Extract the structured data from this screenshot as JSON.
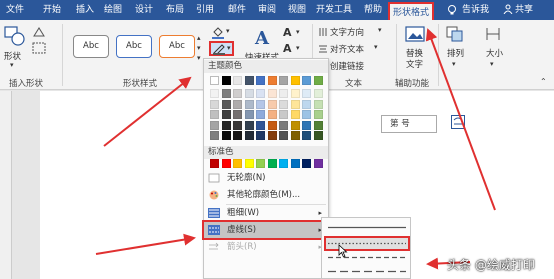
{
  "tabs": [
    {
      "label": "文件"
    },
    {
      "label": "开始"
    },
    {
      "label": "插入"
    },
    {
      "label": "绘图"
    },
    {
      "label": "设计"
    },
    {
      "label": "布局"
    },
    {
      "label": "引用"
    },
    {
      "label": "邮件"
    },
    {
      "label": "审阅"
    },
    {
      "label": "视图"
    },
    {
      "label": "开发工具"
    },
    {
      "label": "帮助"
    },
    {
      "label": "形状格式"
    }
  ],
  "tell_me": "告诉我",
  "share": "共享",
  "ribbon": {
    "insert_shape_group": "插入形状",
    "shape_label": "形状",
    "shape_styles_group": "形状样式",
    "abc_label": "Abc",
    "quick_styles": "快速样式",
    "text_group": "文本",
    "text_direction": "文字方向",
    "align_text": "对齐文本",
    "create_link": "创建链接",
    "accessibility_group": "辅助功能",
    "alt_text_line1": "替换",
    "alt_text_line2": "文字",
    "arrange": "排列",
    "size": "大小"
  },
  "menu": {
    "theme_colors": "主题颜色",
    "standard_colors": "标准色",
    "no_outline": "无轮廓(N)",
    "more_colors": "其他轮廓颜色(M)...",
    "weight": "粗细(W)",
    "dashes": "虚线(S)",
    "arrows": "箭头(R)"
  },
  "colors": {
    "theme_top": [
      "#ffffff",
      "#000000",
      "#e7e6e6",
      "#44546a",
      "#4472c4",
      "#ed7d31",
      "#a5a5a5",
      "#ffc000",
      "#5b9bd5",
      "#70ad47"
    ],
    "theme_shades": [
      [
        "#f2f2f2",
        "#7f7f7f",
        "#d0cece",
        "#d6dce4",
        "#d9e2f3",
        "#fbe5d5",
        "#ededed",
        "#fff2cc",
        "#deebf6",
        "#e2efd9"
      ],
      [
        "#d8d8d8",
        "#595959",
        "#aeabab",
        "#adb9ca",
        "#b4c6e7",
        "#f7cbac",
        "#dbdbdb",
        "#fee599",
        "#bdd7ee",
        "#c5e0b3"
      ],
      [
        "#bfbfbf",
        "#3f3f3f",
        "#757070",
        "#8496b0",
        "#8eaadb",
        "#f4b183",
        "#c9c9c9",
        "#ffd965",
        "#9cc3e5",
        "#a8d08d"
      ],
      [
        "#a5a5a5",
        "#262626",
        "#3a3838",
        "#323f4f",
        "#2f5496",
        "#c55a11",
        "#7b7b7b",
        "#bf9000",
        "#2e75b5",
        "#538135"
      ],
      [
        "#7f7f7f",
        "#0c0c0c",
        "#171616",
        "#222a35",
        "#1f3864",
        "#833c0b",
        "#525252",
        "#7f6000",
        "#1e4e79",
        "#375623"
      ]
    ],
    "standard": [
      "#c00000",
      "#ff0000",
      "#ffc000",
      "#ffff00",
      "#92d050",
      "#00b050",
      "#00b0f0",
      "#0070c0",
      "#002060",
      "#7030a0"
    ],
    "accent_blue": "#2b579a",
    "highlight_red": "#e03030"
  },
  "page": {
    "textbox_text": "第     号"
  },
  "watermark": "头条 @绘威打印"
}
